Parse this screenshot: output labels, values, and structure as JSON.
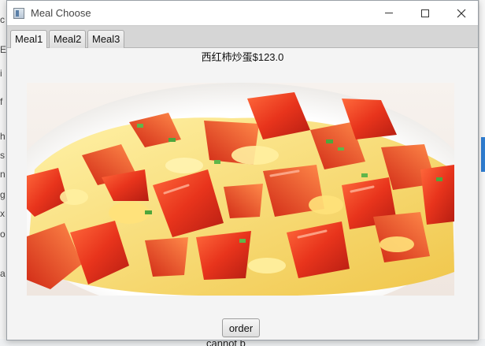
{
  "window": {
    "title": "Meal Choose",
    "minimize_icon": "minimize-icon",
    "maximize_icon": "maximize-icon",
    "close_icon": "close-icon"
  },
  "tabs": [
    {
      "label": "Meal1",
      "active": true
    },
    {
      "label": "Meal2",
      "active": false
    },
    {
      "label": "Meal3",
      "active": false
    }
  ],
  "meal": {
    "label": "西红柿炒蛋$123.0",
    "image": "tomato-egg-dish-photo"
  },
  "order_button": "order",
  "background": {
    "bottom_text": "cannot b",
    "left_fragments": [
      "c",
      "E",
      "i",
      "f",
      "h",
      "s",
      "n",
      "g",
      "x",
      "o",
      "a"
    ]
  }
}
